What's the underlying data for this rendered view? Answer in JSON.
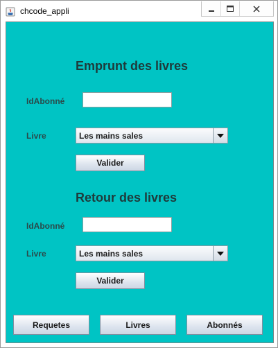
{
  "window": {
    "title": "chcode_appli"
  },
  "borrow_section": {
    "title": "Emprunt des livres",
    "subscriber_label": "IdAbonné",
    "subscriber_value": "",
    "book_label": "Livre",
    "book_selected": "Les mains sales",
    "validate_label": "Valider"
  },
  "return_section": {
    "title": "Retour des livres",
    "subscriber_label": "IdAbonné",
    "subscriber_value": "",
    "book_label": "Livre",
    "book_selected": "Les mains sales",
    "validate_label": "Valider"
  },
  "bottom_nav": {
    "requests_label": "Requetes",
    "books_label": "Livres",
    "subscribers_label": "Abonnés"
  },
  "colors": {
    "panel_background": "#00c4c4",
    "heading_text": "#1e3a3a"
  }
}
